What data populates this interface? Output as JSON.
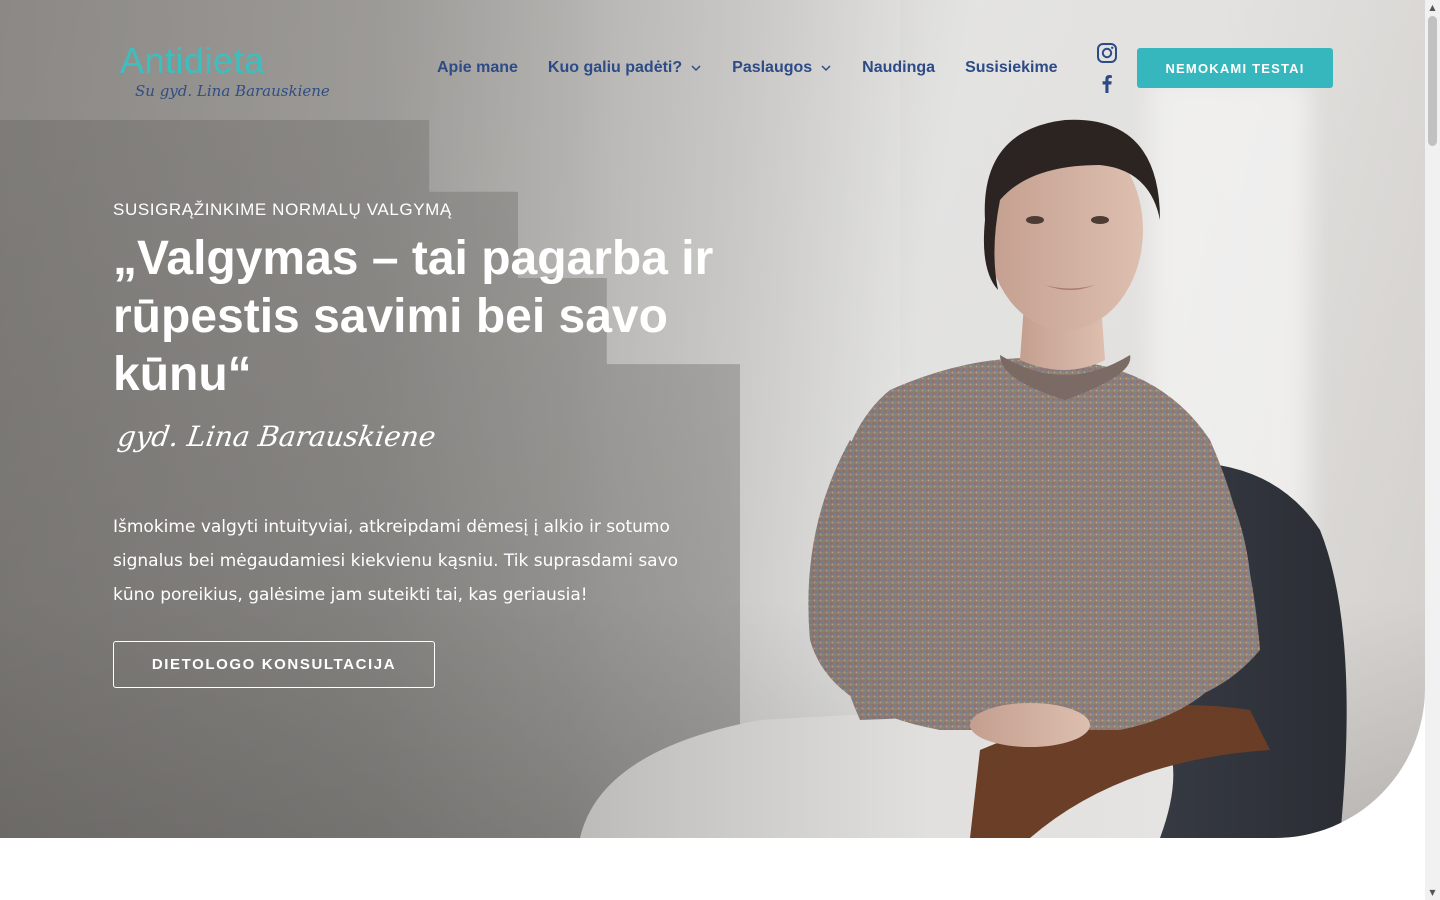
{
  "brand": {
    "logo_text": "Antidieta",
    "logo_subtitle": "Su gyd. Lina Barauskiene"
  },
  "nav": {
    "items": [
      {
        "label": "Apie mane",
        "has_dropdown": false
      },
      {
        "label": "Kuo galiu padėti?",
        "has_dropdown": true
      },
      {
        "label": "Paslaugos",
        "has_dropdown": true
      },
      {
        "label": "Naudinga",
        "has_dropdown": false
      },
      {
        "label": "Susisiekime",
        "has_dropdown": false
      }
    ],
    "social": [
      {
        "icon": "instagram-icon"
      },
      {
        "icon": "facebook-icon"
      }
    ],
    "cta_label": "NEMOKAMI TESTAI"
  },
  "hero": {
    "eyebrow": "SUSIGRĄŽINKIME NORMALŲ VALGYMĄ",
    "headline": "„Valgymas – tai pagarba ir rūpestis savimi bei savo kūnu“",
    "signature": "gyd. Lina Barauskiene",
    "intro": "Išmokime valgyti intuityviai, atkreipdami dėmesį į alkio ir sotumo signalus bei mėgaudamiesi kiekvienu kąsniu. Tik suprasdami savo kūno poreikius, galėsime jam suteikti tai, kas geriausia!",
    "cta_label": "DIETOLOGO KONSULTACIJA"
  },
  "colors": {
    "accent": "#36b7bd",
    "nav_text": "#2d4b86",
    "logo": "#3bbfbf"
  }
}
